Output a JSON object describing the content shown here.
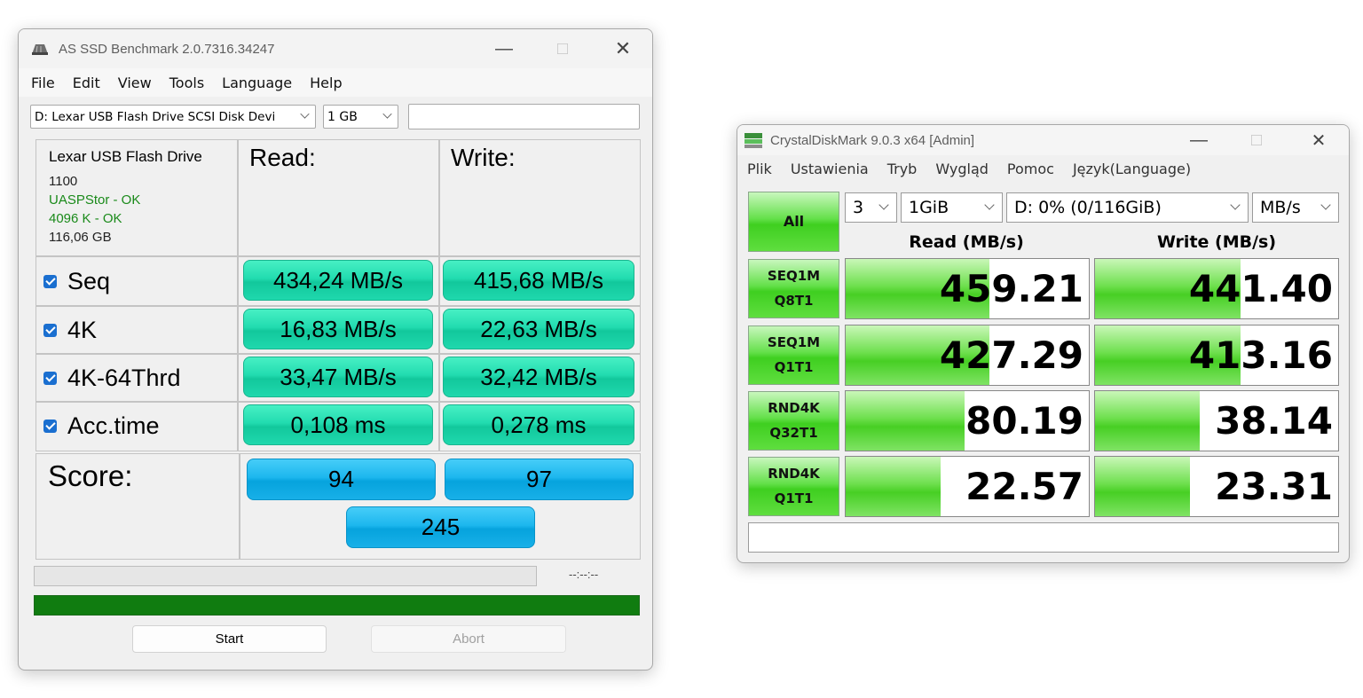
{
  "asssd": {
    "title": "AS SSD Benchmark 2.0.7316.34247",
    "menu": [
      "File",
      "Edit",
      "View",
      "Tools",
      "Language",
      "Help"
    ],
    "drive_select": "D: Lexar USB Flash Drive SCSI Disk Devi",
    "size_select": "1 GB",
    "drive_info": {
      "name": "Lexar USB Flash Drive",
      "firmware": "1100",
      "driver_status": "UASPStor - OK",
      "align_status": "4096 K - OK",
      "capacity": "116,06 GB"
    },
    "read_header": "Read:",
    "write_header": "Write:",
    "rows": [
      {
        "label": "Seq",
        "read": "434,24 MB/s",
        "write": "415,68 MB/s"
      },
      {
        "label": "4K",
        "read": "16,83 MB/s",
        "write": "22,63 MB/s"
      },
      {
        "label": "4K-64Thrd",
        "read": "33,47 MB/s",
        "write": "32,42 MB/s"
      },
      {
        "label": "Acc.time",
        "read": "0,108 ms",
        "write": "0,278 ms"
      }
    ],
    "score_label": "Score:",
    "score_read": "94",
    "score_write": "97",
    "score_total": "245",
    "timer": "--:--:--",
    "progress": 1.0,
    "start_label": "Start",
    "abort_label": "Abort",
    "colors": {
      "result_green": "#22dcb0",
      "score_blue": "#1db7ee",
      "progress_green": "#107c10",
      "ok_green": "#1a8a1a"
    }
  },
  "cdm": {
    "title": "CrystalDiskMark 9.0.3 x64 [Admin]",
    "menu": [
      "Plik",
      "Ustawienia",
      "Tryb",
      "Wygląd",
      "Pomoc",
      "Język(Language)"
    ],
    "all_label": "All",
    "count_select": "3",
    "size_select": "1GiB",
    "drive_select": "D: 0% (0/116GiB)",
    "unit_select": "MB/s",
    "read_header": "Read (MB/s)",
    "write_header": "Write (MB/s)",
    "tests": [
      {
        "line1": "SEQ1M",
        "line2": "Q8T1",
        "read": "459.21",
        "write": "441.40",
        "read_fill": 0.59,
        "write_fill": 0.6
      },
      {
        "line1": "SEQ1M",
        "line2": "Q1T1",
        "read": "427.29",
        "write": "413.16",
        "read_fill": 0.59,
        "write_fill": 0.6
      },
      {
        "line1": "RND4K",
        "line2": "Q32T1",
        "read": "80.19",
        "write": "38.14",
        "read_fill": 0.49,
        "write_fill": 0.43
      },
      {
        "line1": "RND4K",
        "line2": "Q1T1",
        "read": "22.57",
        "write": "23.31",
        "read_fill": 0.39,
        "write_fill": 0.39
      }
    ],
    "colors": {
      "bar_green": "#47cf24"
    }
  }
}
